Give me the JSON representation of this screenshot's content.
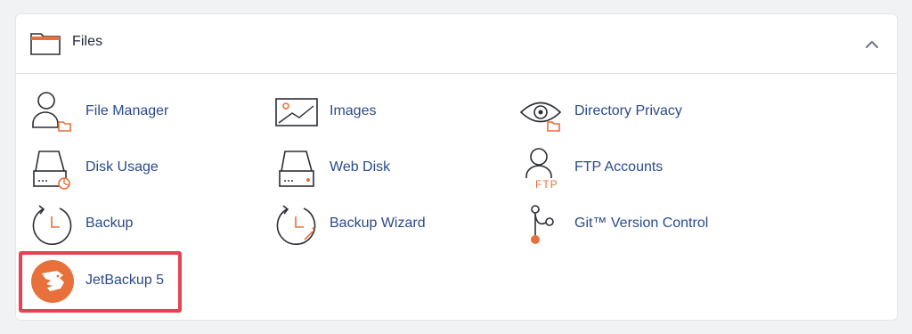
{
  "section": {
    "title": "Files",
    "folder_icon": "folder-icon",
    "collapse_icon": "chevron-up-icon"
  },
  "items": [
    {
      "label": "File Manager",
      "icon": "file-manager-icon"
    },
    {
      "label": "Images",
      "icon": "images-icon"
    },
    {
      "label": "Directory Privacy",
      "icon": "directory-privacy-icon"
    },
    {
      "label": "Disk Usage",
      "icon": "disk-usage-icon"
    },
    {
      "label": "Web Disk",
      "icon": "web-disk-icon"
    },
    {
      "label": "FTP Accounts",
      "icon": "ftp-accounts-icon"
    },
    {
      "label": "Backup",
      "icon": "backup-icon"
    },
    {
      "label": "Backup Wizard",
      "icon": "backup-wizard-icon"
    },
    {
      "label": "Git™ Version Control",
      "icon": "git-version-control-icon"
    },
    {
      "label": "JetBackup 5",
      "icon": "jetbackup-icon"
    }
  ],
  "colors": {
    "accent_orange": "#e8703a",
    "link_blue": "#2a4a8a",
    "highlight_red": "#e8414f",
    "icon_stroke": "#2b2e33"
  }
}
